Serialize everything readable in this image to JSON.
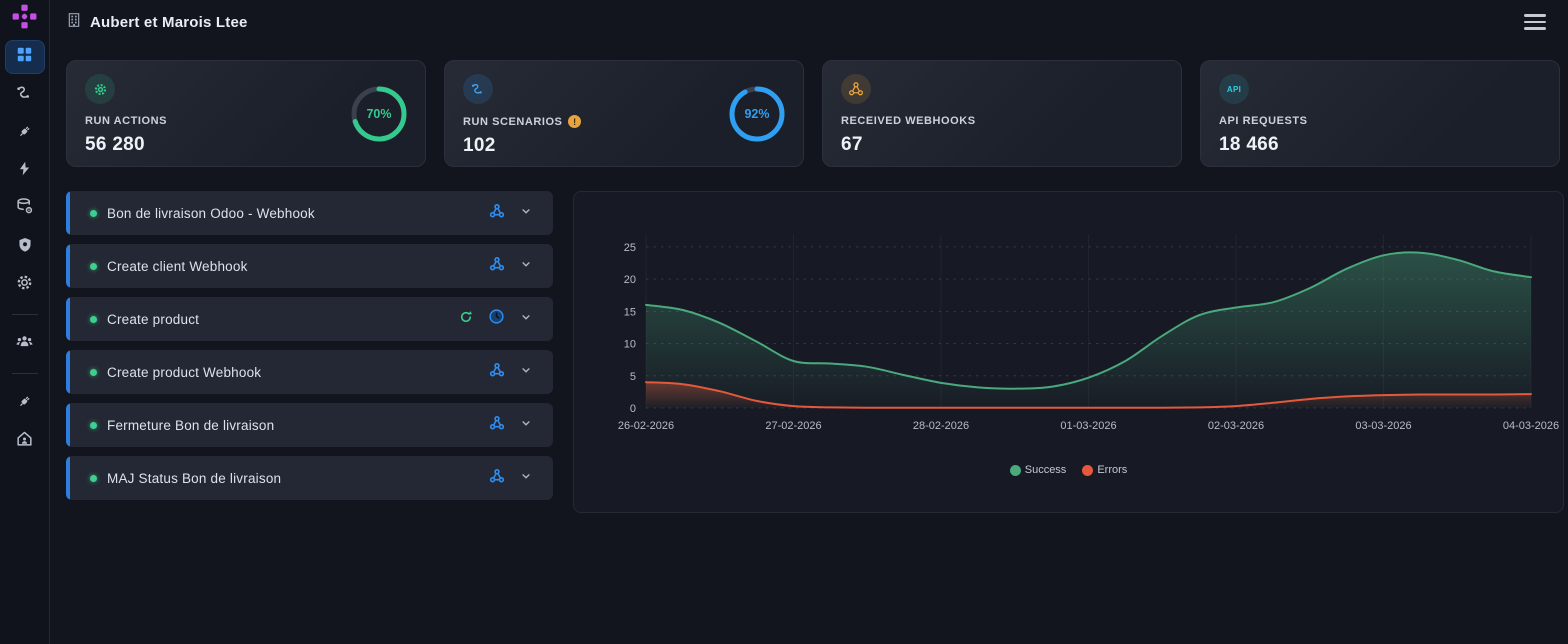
{
  "header": {
    "title": "Aubert et Marois Ltee"
  },
  "sidebar": {
    "items": [
      {
        "name": "logo",
        "icon": "integration-logo-icon"
      },
      {
        "name": "dashboard",
        "icon": "dashboard-grid-icon",
        "active": true
      },
      {
        "name": "scenarios",
        "icon": "route-icon"
      },
      {
        "name": "connections",
        "icon": "plug-icon"
      },
      {
        "name": "instant-triggers",
        "icon": "bolt-icon"
      },
      {
        "name": "data-stores",
        "icon": "database-gear-icon"
      },
      {
        "name": "security",
        "icon": "shield-icon"
      },
      {
        "name": "settings",
        "icon": "gear-icon"
      },
      {
        "name": "team",
        "icon": "users-icon"
      },
      {
        "name": "integrations",
        "icon": "plug-icon"
      },
      {
        "name": "account",
        "icon": "home-user-icon"
      }
    ]
  },
  "stat_cards": [
    {
      "label": "RUN ACTIONS",
      "value": "56 280",
      "icon": "gear-icon",
      "accent": "#34c98e",
      "ring": {
        "percent": 70,
        "label": "70%",
        "color": "#34c98e",
        "track": "#3a404c"
      }
    },
    {
      "label": "RUN SCENARIOS",
      "value": "102",
      "icon": "route-icon",
      "accent": "#3da5f4",
      "badge": "!",
      "ring": {
        "percent": 92,
        "label": "92%",
        "color": "#2f9ff2",
        "track": "#3a404c"
      }
    },
    {
      "label": "RECEIVED WEBHOOKS",
      "value": "67",
      "icon": "webhook-icon",
      "accent": "#e8a33d"
    },
    {
      "label": "API REQUESTS",
      "value": "18 466",
      "icon": "api-badge-icon",
      "icon_text": "API",
      "accent": "#2bb8c9"
    }
  ],
  "scenario_list": [
    {
      "label": "Bon de livraison Odoo - Webhook",
      "status": "active",
      "trailing_icons": [
        "webhook-icon",
        "chevron-down-icon"
      ]
    },
    {
      "label": "Create client Webhook",
      "status": "active",
      "trailing_icons": [
        "webhook-icon",
        "chevron-down-icon"
      ]
    },
    {
      "label": "Create product",
      "status": "active",
      "trailing_icons": [
        "refresh-icon",
        "clock-icon",
        "chevron-down-icon"
      ]
    },
    {
      "label": "Create product Webhook",
      "status": "active",
      "trailing_icons": [
        "webhook-icon",
        "chevron-down-icon"
      ]
    },
    {
      "label": "Fermeture Bon de livraison",
      "status": "active",
      "trailing_icons": [
        "webhook-icon",
        "chevron-down-icon"
      ]
    },
    {
      "label": "MAJ Status Bon de livraison",
      "status": "active",
      "trailing_icons": [
        "webhook-icon",
        "chevron-down-icon"
      ]
    }
  ],
  "chart_data": {
    "type": "area",
    "x_ticks": [
      "26-02-2026",
      "27-02-2026",
      "28-02-2026",
      "01-03-2026",
      "02-03-2026",
      "03-03-2026",
      "04-03-2026"
    ],
    "y_ticks": [
      0,
      5,
      10,
      15,
      20,
      25
    ],
    "ylim": [
      0,
      27
    ],
    "xlim_days": [
      0,
      6
    ],
    "grid": "dashed-horizontal",
    "legend_position": "bottom-center",
    "series": [
      {
        "name": "Success",
        "color": "#4aa97d",
        "x": [
          0,
          0.25,
          0.5,
          0.75,
          1,
          1.25,
          1.5,
          1.75,
          2,
          2.25,
          2.5,
          2.75,
          3,
          3.25,
          3.5,
          3.75,
          4,
          4.25,
          4.5,
          4.75,
          5,
          5.25,
          5.5,
          5.75,
          6
        ],
        "values": [
          16,
          15.2,
          13.2,
          10.3,
          7.3,
          6.9,
          6.4,
          5.1,
          3.9,
          3.2,
          3,
          3.3,
          4.7,
          7.3,
          11.2,
          14.4,
          15.6,
          16.4,
          18.6,
          21.6,
          23.7,
          24.1,
          23,
          21.2,
          20.3
        ]
      },
      {
        "name": "Errors",
        "color": "#e2593c",
        "x": [
          0,
          0.25,
          0.5,
          0.75,
          1,
          1.25,
          1.5,
          1.75,
          2,
          2.25,
          2.5,
          2.75,
          3,
          3.25,
          3.5,
          3.75,
          4,
          4.25,
          4.5,
          4.75,
          5,
          5.25,
          5.5,
          5.75,
          6
        ],
        "values": [
          4,
          3.7,
          2.6,
          1.1,
          0.3,
          0.1,
          0.05,
          0.05,
          0.05,
          0.05,
          0.05,
          0.05,
          0.05,
          0.05,
          0.05,
          0.1,
          0.3,
          0.8,
          1.4,
          1.8,
          2,
          2.1,
          2.1,
          2.1,
          2.15
        ]
      }
    ]
  }
}
